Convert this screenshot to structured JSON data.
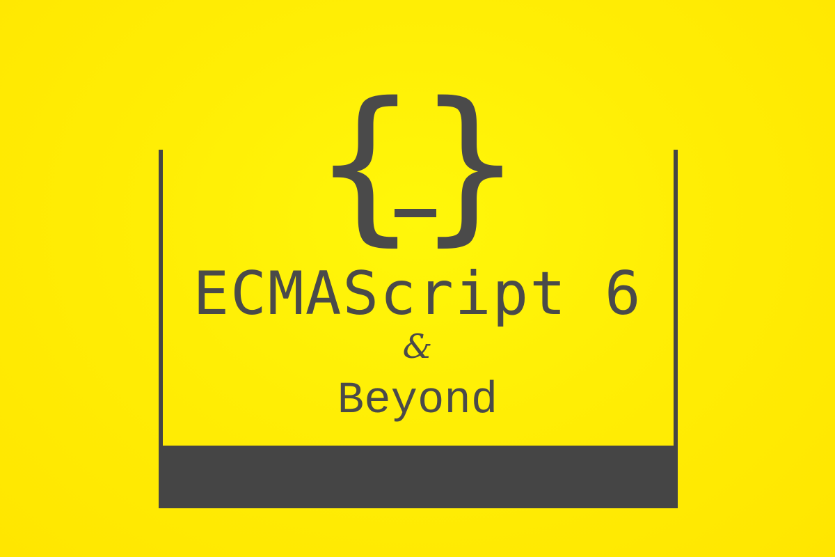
{
  "logo": {
    "open_brace": "{",
    "close_brace": "}",
    "icon": "code-braces-cursor-icon"
  },
  "title": "ECMAScript 6",
  "ampersand": "&",
  "subtitle": "Beyond",
  "colors": {
    "background": "#ffee05",
    "foreground": "#4a4a4a"
  }
}
